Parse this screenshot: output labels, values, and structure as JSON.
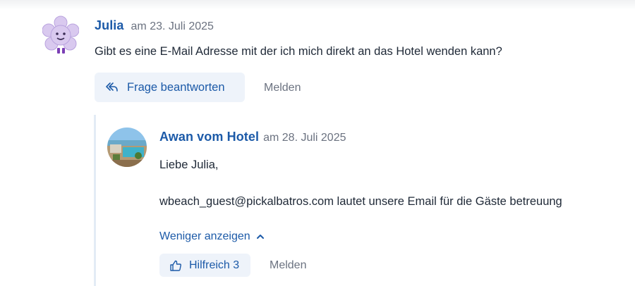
{
  "question": {
    "author": "Julia",
    "date": "am 23. Juli 2025",
    "text": "Gibt es eine E-Mail Adresse mit der ich mich direkt an das Hotel wenden kann?",
    "answer_button": "Frage beantworten",
    "report_link": "Melden",
    "avatar_icon": "flower-mascot-avatar"
  },
  "reply": {
    "author": "Awan vom Hotel",
    "date": "am 28. Juli 2025",
    "line1": "Liebe Julia,",
    "line2": "wbeach_guest@pickalbatros.com lautet unsere Email für die Gäste betreuung",
    "show_less": "Weniger anzeigen",
    "helpful_button": "Hilfreich 3",
    "report_link": "Melden",
    "avatar_icon": "hotel-photo-avatar"
  },
  "colors": {
    "accent": "#1c5aa8",
    "button_bg": "#eef3fa",
    "muted_text": "#6b7280",
    "thread_line": "#e3ecf5"
  }
}
